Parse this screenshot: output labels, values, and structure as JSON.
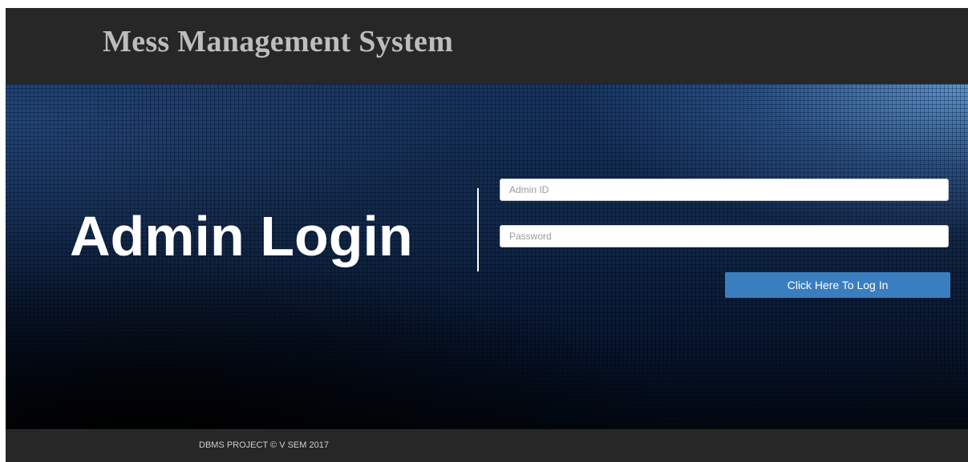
{
  "header": {
    "title": "Mess Management System"
  },
  "hero": {
    "heading": "Admin Login"
  },
  "login_form": {
    "admin_id": {
      "value": "",
      "placeholder": "Admin ID"
    },
    "password": {
      "value": "",
      "placeholder": "Password"
    },
    "submit_label": "Click Here To Log In"
  },
  "footer": {
    "text": "DBMS PROJECT © V SEM 2017"
  },
  "colors": {
    "header_bg": "#272727",
    "footer_bg": "#272727",
    "title_text": "#bdbdbd",
    "button_bg": "#3a7ec0",
    "hero_highlight": "#5d98d6",
    "hero_dark": "#020811"
  }
}
